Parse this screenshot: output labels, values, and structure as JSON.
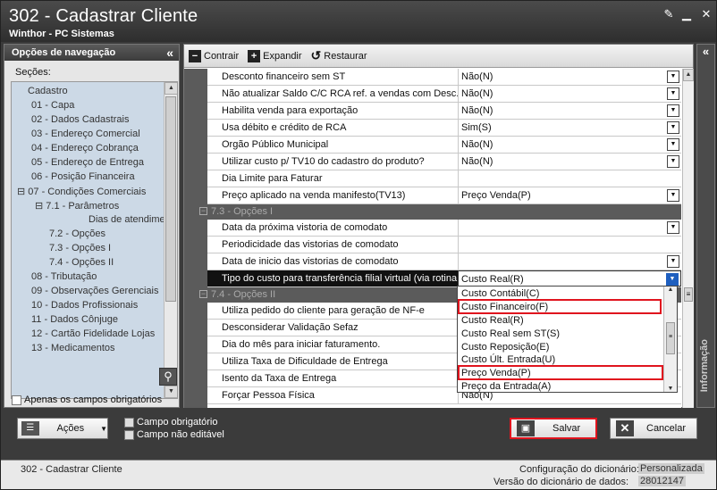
{
  "window": {
    "title": "302 - Cadastrar Cliente",
    "subtitle": "Winthor - PC Sistemas"
  },
  "nav": {
    "header": "Opções de navegação",
    "sections_label": "Seções:",
    "items": [
      "Cadastro",
      "01 - Capa",
      "02 - Dados Cadastrais",
      "03 - Endereço Comercial",
      "04 - Endereço Cobrança",
      "05 - Endereço de Entrega",
      "06 - Posição Financeira",
      "07 - Condições Comerciais",
      "7.1 - Parâmetros",
      "Dias de atendimento",
      "7.2 - Opções",
      "7.3 - Opções I",
      "7.4 - Opções II",
      "08 - Tributação",
      "09 - Observações Gerenciais",
      "10 - Dados Profissionais",
      "11 - Dados Cônjuge",
      "12 - Cartão Fidelidade Lojas",
      "13 - Medicamentos"
    ],
    "required_only_label": "Apenas os campos obrigatórios"
  },
  "toolbar": {
    "collapse_label": "Contrair",
    "expand_label": "Expandir",
    "restore_label": "Restaurar"
  },
  "grid": {
    "rows_a": [
      {
        "label": "Desconto financeiro sem ST",
        "value": "Não(N)",
        "dropdown": true
      },
      {
        "label": "Não atualizar Saldo C/C RCA ref. a vendas com Desc.",
        "value": "Não(N)",
        "dropdown": true
      },
      {
        "label": "Habilita venda para exportação",
        "value": "Não(N)",
        "dropdown": true
      },
      {
        "label": "Usa débito e crédito de RCA",
        "value": "Sim(S)",
        "dropdown": true
      },
      {
        "label": "Orgão Público Municipal",
        "value": "Não(N)",
        "dropdown": true
      },
      {
        "label": "Utilizar custo p/ TV10 do cadastro do produto?",
        "value": "Não(N)",
        "dropdown": true
      },
      {
        "label": "Dia Limite para Faturar",
        "value": "",
        "dropdown": false
      },
      {
        "label": "Preço aplicado na venda manifesto(TV13)",
        "value": "Preço Venda(P)",
        "dropdown": true
      }
    ],
    "category_73": "7.3 - Opções I",
    "rows_b": [
      {
        "label": "Data da próxima vistoria de comodato",
        "value": "",
        "dropdown": true
      },
      {
        "label": "Periodicidade das vistorias de comodato",
        "value": "",
        "dropdown": false
      },
      {
        "label": "Data de inicio das vistorias de comodato",
        "value": "",
        "dropdown": true
      }
    ],
    "selected_row": {
      "label": "Tipo do custo  para transferência  filial virtual (via rotina",
      "value": "Custo Real(R)"
    },
    "category_74": "7.4 - Opções II",
    "rows_c": [
      {
        "label": "Utiliza pedido do cliente para geração de NF-e",
        "value": ""
      },
      {
        "label": "Desconsiderar Validação Sefaz",
        "value": ""
      },
      {
        "label": "Dia do mês para iniciar faturamento.",
        "value": ""
      },
      {
        "label": "Utiliza Taxa de Dificuldade de Entrega",
        "value": ""
      },
      {
        "label": "Isento da Taxa de Entrega",
        "value": ""
      },
      {
        "label": "Forçar Pessoa Física",
        "value": "Não(N)"
      }
    ]
  },
  "dropdown_options": [
    "Custo Contábil(C)",
    "Custo Financeiro(F)",
    "Custo Real(R)",
    "Custo Real sem ST(S)",
    "Custo Reposição(E)",
    "Custo Últ. Entrada(U)",
    "Preço Venda(P)",
    "Preço da Entrada(A)"
  ],
  "info_panel_label": "Informação",
  "actions": {
    "actions_label": "Ações",
    "required_field_label": "Campo obrigatório",
    "not_editable_label": "Campo não editável",
    "save_label": "Salvar",
    "cancel_label": "Cancelar"
  },
  "status": {
    "left_text": "302 - Cadastrar Cliente",
    "dict_config_label": "Configuração do dicionário:",
    "dict_config_value": "Personalizada",
    "dict_version_label": "Versão do dicionário de dados:",
    "dict_version_value": "28012147"
  },
  "colors": {
    "highlight_box": "#e0141e",
    "selected_row_bg": "#111111",
    "nav_bg": "#ccd9e6"
  }
}
